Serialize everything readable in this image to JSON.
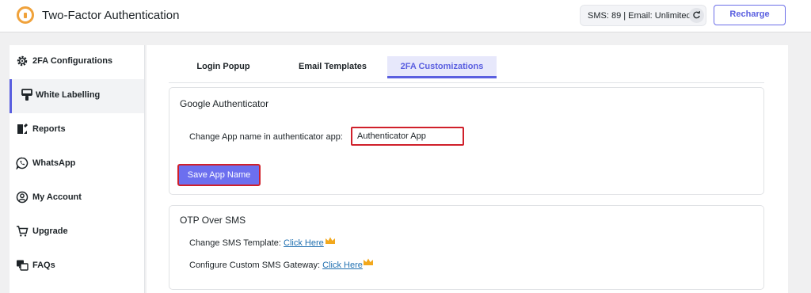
{
  "header": {
    "title": "Two-Factor Authentication",
    "usage": "SMS: 89 | Email: Unlimited",
    "recharge_label": "Recharge",
    "logo_icon": "lock-logo-icon",
    "accent_color": "#5a5fe0"
  },
  "sidebar": {
    "items": [
      {
        "label": "2FA Configurations",
        "icon": "gear-icon"
      },
      {
        "label": "White Labelling",
        "icon": "paint-brush-icon"
      },
      {
        "label": "Reports",
        "icon": "report-icon"
      },
      {
        "label": "WhatsApp",
        "icon": "whatsapp-icon"
      },
      {
        "label": "My Account",
        "icon": "user-circle-icon"
      },
      {
        "label": "Upgrade",
        "icon": "cart-icon"
      },
      {
        "label": "FAQs",
        "icon": "faq-icon"
      }
    ],
    "active": "White Labelling"
  },
  "tabs": [
    "Login Popup",
    "Email Templates",
    "2FA Customizations"
  ],
  "active_tab": "2FA Customizations",
  "google_auth": {
    "title": "Google Authenticator",
    "label": "Change App name in authenticator app:",
    "value": "Authenticator App",
    "save_label": "Save App Name"
  },
  "otp_sms": {
    "title": "OTP Over SMS",
    "template_label": "Change SMS Template:",
    "template_link": "Click Here",
    "gateway_label": "Configure Custom SMS Gateway:",
    "gateway_link": "Click Here"
  }
}
